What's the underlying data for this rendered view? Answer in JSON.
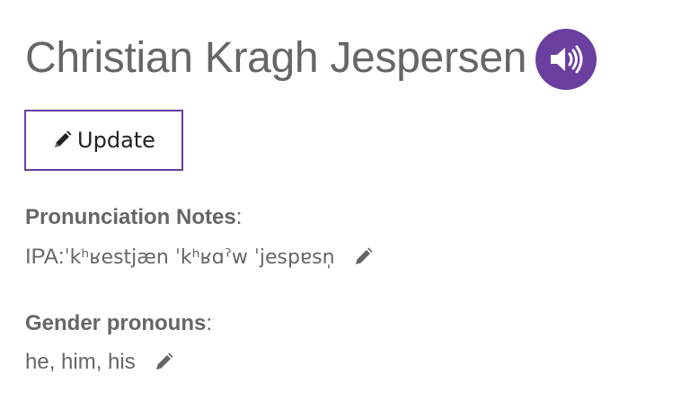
{
  "profile": {
    "name": "Christian Kragh Jespersen"
  },
  "actions": {
    "update_label": "Update"
  },
  "pronunciation": {
    "label": "Pronunciation Notes",
    "separator": ":",
    "ipa_prefix": "IPA: ",
    "ipa_value": "ˈkʰʁestjæn ˈkʰʁɑˀw ˈjespɐsn̩"
  },
  "gender": {
    "label": "Gender pronouns",
    "separator": ":",
    "value": "he, him, his"
  },
  "colors": {
    "accent": "#6a3fa0",
    "text": "#666666"
  },
  "icons": {
    "audio": "speaker-icon",
    "edit": "pencil-icon"
  }
}
